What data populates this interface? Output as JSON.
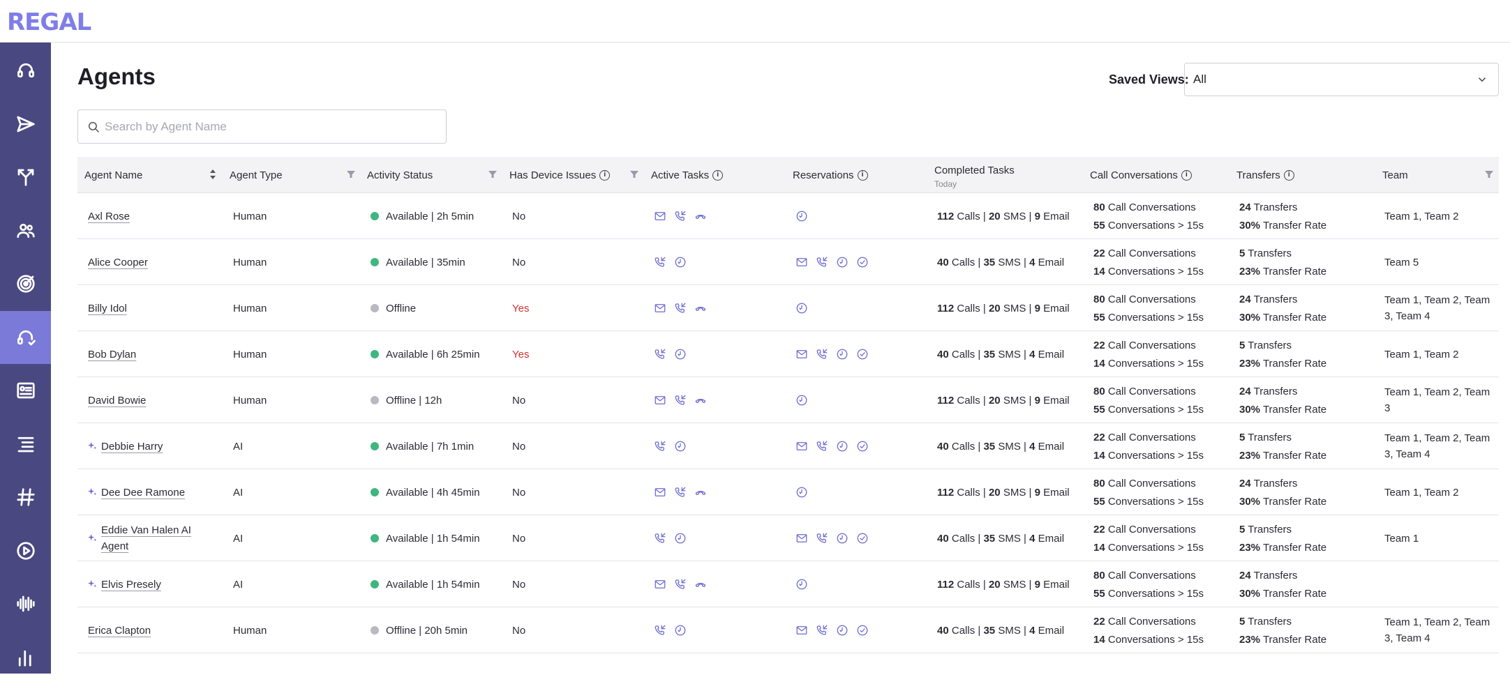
{
  "app": {
    "logo": "REGAL"
  },
  "sidebar": {
    "items": [
      {
        "icon": "headset-icon"
      },
      {
        "icon": "send-icon"
      },
      {
        "icon": "branch-icon"
      },
      {
        "icon": "contacts-icon"
      },
      {
        "icon": "target-icon"
      },
      {
        "icon": "agents-headset-icon",
        "active": true
      },
      {
        "icon": "profile-card-icon"
      },
      {
        "icon": "list-icon"
      },
      {
        "icon": "hashtag-icon"
      },
      {
        "icon": "play-icon"
      },
      {
        "icon": "waveform-icon"
      },
      {
        "icon": "bar-chart-icon"
      }
    ]
  },
  "page": {
    "title": "Agents",
    "saved_views_label": "Saved Views:",
    "saved_views_value": "All",
    "search_placeholder": "Search by Agent Name"
  },
  "columns": {
    "agent_name": "Agent Name",
    "agent_type": "Agent Type",
    "activity_status": "Activity Status",
    "has_device_issues": "Has Device Issues",
    "active_tasks": "Active Tasks",
    "reservations": "Reservations",
    "completed_tasks": "Completed Tasks",
    "completed_tasks_sub": "Today",
    "call_conversations": "Call Conversations",
    "transfers": "Transfers",
    "team": "Team"
  },
  "colors": {
    "available": "#3fb67f",
    "offline": "#b9b9c2",
    "accent": "#6b6ad0",
    "sidebar": "#4a4880",
    "sidebar_active": "#7b7ad8"
  },
  "rows": [
    {
      "name": "Axl Rose",
      "ai": false,
      "type": "Human",
      "status": "Available | 2h 5min",
      "online": true,
      "device": "No",
      "active": [
        "mail",
        "phone",
        "hangup"
      ],
      "reservations": [
        "clock"
      ],
      "calls": "112",
      "sms": "20",
      "email": "9",
      "cc": "80",
      "cc15": "55",
      "transfers": "24",
      "rate": "30%",
      "team": "Team 1, Team 2"
    },
    {
      "name": "Alice Cooper",
      "ai": false,
      "type": "Human",
      "status": "Available | 35min",
      "online": true,
      "device": "No",
      "active": [
        "phone",
        "clock"
      ],
      "reservations": [
        "mail",
        "phone",
        "clock",
        "check"
      ],
      "calls": "40",
      "sms": "35",
      "email": "4",
      "cc": "22",
      "cc15": "14",
      "transfers": "5",
      "rate": "23%",
      "team": "Team 5"
    },
    {
      "name": "Billy Idol",
      "ai": false,
      "type": "Human",
      "status": "Offline",
      "online": false,
      "device": "Yes",
      "active": [
        "mail",
        "phone",
        "hangup"
      ],
      "reservations": [
        "clock"
      ],
      "calls": "112",
      "sms": "20",
      "email": "9",
      "cc": "80",
      "cc15": "55",
      "transfers": "24",
      "rate": "30%",
      "team": "Team 1, Team 2, Team 3, Team 4"
    },
    {
      "name": "Bob Dylan",
      "ai": false,
      "type": "Human",
      "status": "Available | 6h 25min",
      "online": true,
      "device": "Yes",
      "active": [
        "phone",
        "clock"
      ],
      "reservations": [
        "mail",
        "phone",
        "clock",
        "check"
      ],
      "calls": "40",
      "sms": "35",
      "email": "4",
      "cc": "22",
      "cc15": "14",
      "transfers": "5",
      "rate": "23%",
      "team": "Team 1, Team 2"
    },
    {
      "name": "David Bowie",
      "ai": false,
      "type": "Human",
      "status": "Offline | 12h",
      "online": false,
      "device": "No",
      "active": [
        "mail",
        "phone",
        "hangup"
      ],
      "reservations": [
        "clock"
      ],
      "calls": "112",
      "sms": "20",
      "email": "9",
      "cc": "80",
      "cc15": "55",
      "transfers": "24",
      "rate": "30%",
      "team": "Team 1, Team 2, Team 3"
    },
    {
      "name": "Debbie Harry",
      "ai": true,
      "type": "AI",
      "status": "Available | 7h 1min",
      "online": true,
      "device": "No",
      "active": [
        "phone",
        "clock"
      ],
      "reservations": [
        "mail",
        "phone",
        "clock",
        "check"
      ],
      "calls": "40",
      "sms": "35",
      "email": "4",
      "cc": "22",
      "cc15": "14",
      "transfers": "5",
      "rate": "23%",
      "team": "Team 1, Team 2, Team 3, Team 4"
    },
    {
      "name": "Dee Dee Ramone",
      "ai": true,
      "type": "AI",
      "status": "Available | 4h 45min",
      "online": true,
      "device": "No",
      "active": [
        "mail",
        "phone",
        "hangup"
      ],
      "reservations": [
        "clock"
      ],
      "calls": "112",
      "sms": "20",
      "email": "9",
      "cc": "80",
      "cc15": "55",
      "transfers": "24",
      "rate": "30%",
      "team": "Team 1, Team 2"
    },
    {
      "name": "Eddie Van Halen AI Agent",
      "ai": true,
      "type": "AI",
      "status": "Available | 1h 54min",
      "online": true,
      "device": "No",
      "active": [
        "phone",
        "clock"
      ],
      "reservations": [
        "mail",
        "phone",
        "clock",
        "check"
      ],
      "calls": "40",
      "sms": "35",
      "email": "4",
      "cc": "22",
      "cc15": "14",
      "transfers": "5",
      "rate": "23%",
      "team": "Team 1"
    },
    {
      "name": "Elvis Presely",
      "ai": true,
      "type": "AI",
      "status": "Available | 1h 54min",
      "online": true,
      "device": "No",
      "active": [
        "mail",
        "phone",
        "hangup"
      ],
      "reservations": [
        "clock"
      ],
      "calls": "112",
      "sms": "20",
      "email": "9",
      "cc": "80",
      "cc15": "55",
      "transfers": "24",
      "rate": "30%",
      "team": ""
    },
    {
      "name": "Erica Clapton",
      "ai": false,
      "type": "Human",
      "status": "Offline | 20h 5min",
      "online": false,
      "device": "No",
      "active": [
        "phone",
        "clock"
      ],
      "reservations": [
        "mail",
        "phone",
        "clock",
        "check"
      ],
      "calls": "40",
      "sms": "35",
      "email": "4",
      "cc": "22",
      "cc15": "14",
      "transfers": "5",
      "rate": "23%",
      "team": "Team 1, Team 2, Team 3, Team 4"
    }
  ],
  "labels": {
    "calls": "Calls",
    "sms": "SMS",
    "email": "Email",
    "sep": "|",
    "call_conversations": "Call Conversations",
    "conversations_15s": "Conversations > 15s",
    "transfers": "Transfers",
    "transfer_rate": "Transfer Rate"
  }
}
